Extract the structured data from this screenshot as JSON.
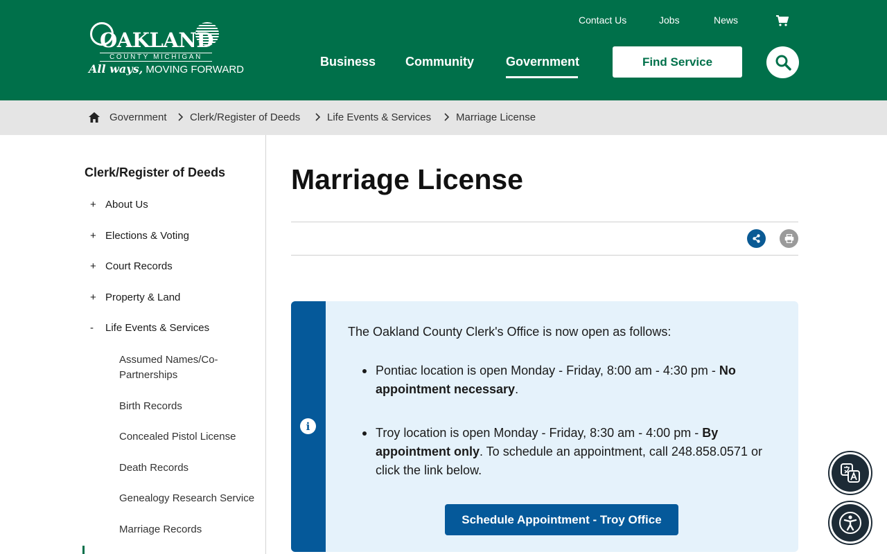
{
  "header": {
    "logo": {
      "wordmark": "OAKLAND",
      "subtitle": "COUNTY MICHIGAN",
      "tagline_script": "All ways,",
      "tagline": "MOVING FORWARD"
    },
    "utility_nav": [
      "Contact Us",
      "Jobs",
      "News"
    ],
    "main_nav": [
      "Business",
      "Community",
      "Government"
    ],
    "active_main_nav": "Government",
    "find_service_label": "Find Service"
  },
  "breadcrumb": [
    "Government",
    "Clerk/Register of Deeds",
    "Life Events & Services",
    "Marriage License"
  ],
  "sidebar": {
    "title": "Clerk/Register of Deeds",
    "items": [
      {
        "sign": "+",
        "label": "About Us"
      },
      {
        "sign": "+",
        "label": "Elections & Voting"
      },
      {
        "sign": "+",
        "label": "Court Records"
      },
      {
        "sign": "+",
        "label": "Property & Land"
      },
      {
        "sign": "-",
        "label": "Life Events & Services"
      }
    ],
    "subitems": [
      "Assumed Names/Co-Partnerships",
      "Birth Records",
      "Concealed Pistol License",
      "Death Records",
      "Genealogy Research Service",
      "Marriage Records"
    ]
  },
  "main": {
    "title": "Marriage License",
    "alert": {
      "intro": "The Oakland County Clerk's Office is now open as follows:",
      "item1_text": "Pontiac location is open Monday - Friday, 8:00 am - 4:30 pm - ",
      "item1_bold": "No appointment necessary",
      "item1_end": ".",
      "item2_text": "Troy location is open Monday - Friday, 8:30 am - 4:00 pm - ",
      "item2_bold": "By appointment only",
      "item2_end": ". To schedule an appointment, call 248.858.0571 or click the link below.",
      "button_label": "Schedule Appointment - Troy Office"
    }
  },
  "colors": {
    "brand_green": "#00704a",
    "brand_blue": "#05599a",
    "alert_bg": "#e5f2fb"
  }
}
